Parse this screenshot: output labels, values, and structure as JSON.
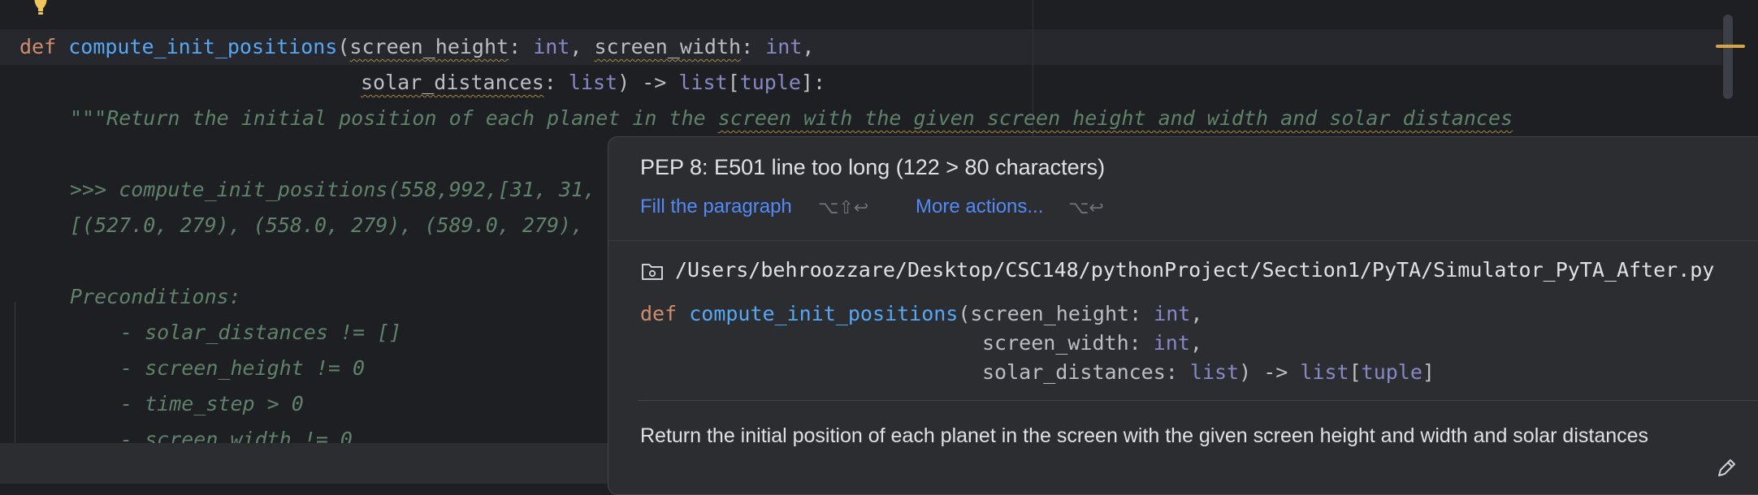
{
  "editor": {
    "line1": {
      "kw": "def",
      "fn": "compute_init_positions",
      "open": "(",
      "p1": "screen_height",
      "c1": ": ",
      "t1": "int",
      "sep1": ", ",
      "p2": "screen_width",
      "c2": ": ",
      "t2": "int",
      "tail": ","
    },
    "line2": {
      "p3": "solar_distances",
      "c3": ": ",
      "t3": "list",
      "arrow": ") -> ",
      "t4": "list",
      "br1": "[",
      "t5": "tuple",
      "br2": "]:"
    },
    "docstring": [
      "\"\"\"Return the initial position of each planet in the ",
      "screen with the given screen height and width and solar distances",
      ">>> compute_init_positions(558,992,[31, 31,",
      "[(527.0, 279), (558.0, 279), (589.0, 279),",
      "Preconditions:",
      "- solar_distances != []",
      "- screen_height != 0",
      "- time_step > 0",
      "- screen_width != 0"
    ]
  },
  "popup": {
    "title": "PEP 8: E501 line too long (122 > 80 characters)",
    "action1": "Fill the paragraph",
    "action1_shortcut": "⌥⇧↩",
    "action2": "More actions...",
    "action2_shortcut": "⌥↩",
    "path": "/Users/behroozzare/Desktop/CSC148/pythonProject/Section1/PyTA/Simulator_PyTA_After.py",
    "signature": {
      "kw": "def",
      "fn": "compute_init_positions",
      "l1_open": "(",
      "p1": "screen_height",
      "c1": ": ",
      "t1": "int",
      "e1": ",",
      "p2": "screen_width",
      "c2": ": ",
      "t2": "int",
      "e2": ",",
      "p3": "solar_distances",
      "c3": ": ",
      "t3": "list",
      "arrow": ") -> ",
      "t4": "list",
      "br1": "[",
      "t5": "tuple",
      "br2": "]"
    },
    "description": "Return the initial position of each planet in the screen with the given screen height and width and solar distances"
  },
  "colors": {
    "background": "#1e1f22",
    "keyword": "#cf8e6d",
    "function": "#56a8f5",
    "type": "#8888c6",
    "docstring": "#5f826b",
    "link": "#548af7"
  },
  "icons": [
    "lightbulb-icon",
    "folder-icon",
    "pencil-icon"
  ]
}
